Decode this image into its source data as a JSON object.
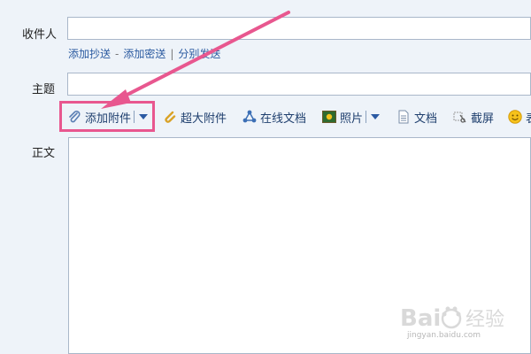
{
  "fields": {
    "recipient_label": "收件人",
    "subject_label": "主题",
    "body_label": "正文"
  },
  "links": {
    "add_cc": "添加抄送",
    "add_bcc": "添加密送",
    "separate_send": "分别发送",
    "dash": "-",
    "bar": "|"
  },
  "toolbar": {
    "add_attachment": "添加附件",
    "large_attachment": "超大附件",
    "online_docs": "在线文档",
    "photo": "照片",
    "document": "文档",
    "screenshot": "截屏",
    "emoji_partial": "表"
  },
  "watermark": {
    "site": "jingyan.baidu.com"
  },
  "colors": {
    "highlight": "#e8578f",
    "link": "#2a5aa0",
    "background": "#eef3f9"
  }
}
